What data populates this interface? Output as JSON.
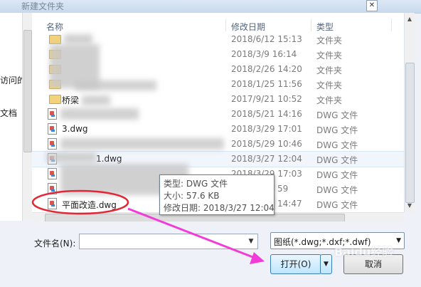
{
  "window": {
    "title": "新建文件夹"
  },
  "left_pane": {
    "items": [
      "访问的",
      "文档"
    ]
  },
  "columns": {
    "name": "名称",
    "date": "修改日期",
    "type": "类型"
  },
  "files": [
    {
      "name": "",
      "date": "2018/6/12 15:13",
      "type": "文件夹",
      "icon": "folder-icon"
    },
    {
      "name": "",
      "date": "2018/3/9 16:14",
      "type": "文件夹",
      "icon": "folder-icon"
    },
    {
      "name": "",
      "date": "2018/2/26 14:20",
      "type": "文件夹",
      "icon": "folder-icon"
    },
    {
      "name": "",
      "date": "2018/1/25 11:56",
      "type": "文件夹",
      "icon": "folder-icon"
    },
    {
      "name": "桥梁",
      "date": "2017/9/21 10:52",
      "type": "文件夹",
      "icon": "folder-icon"
    },
    {
      "name": "",
      "date": "2018/5/21 14:16",
      "type": "DWG 文件",
      "icon": "dwg-file-icon"
    },
    {
      "name": "3.dwg",
      "date": "2018/3/29 17:01",
      "type": "DWG 文件",
      "icon": "dwg-file-icon"
    },
    {
      "name": "",
      "date": "2018/5/29 10:46",
      "type": "DWG 文件",
      "icon": "dwg-file-icon"
    },
    {
      "name": "1.dwg",
      "date": "2018/3/27 12:04",
      "type": "DWG 文件",
      "icon": "dwg-file-icon"
    },
    {
      "name": "",
      "date": "2018/3/29 17:03",
      "type": "DWG 文件",
      "icon": "dwg-file-icon"
    },
    {
      "name": "",
      "date": "59",
      "type": "DWG 文件",
      "icon": "dwg-file-icon"
    },
    {
      "name": "平面改造.dwg",
      "date": "14:47",
      "type": "DWG 文件",
      "icon": "dwg-file-icon"
    }
  ],
  "tooltip": {
    "type_line": "类型: DWG 文件",
    "size_line": "大小: 57.6 KB",
    "date_line": "修改日期: 2018/3/27 12:04"
  },
  "filename": {
    "label": "文件名(N):",
    "value": ""
  },
  "filter": {
    "selected": "图纸(*.dwg;*.dxf;*.dwf)"
  },
  "buttons": {
    "open": "打开(O)",
    "cancel": "取消"
  },
  "watermark": "Baidu经验",
  "colors": {
    "annotation": "#e32636",
    "arrow": "#f23bd7"
  }
}
